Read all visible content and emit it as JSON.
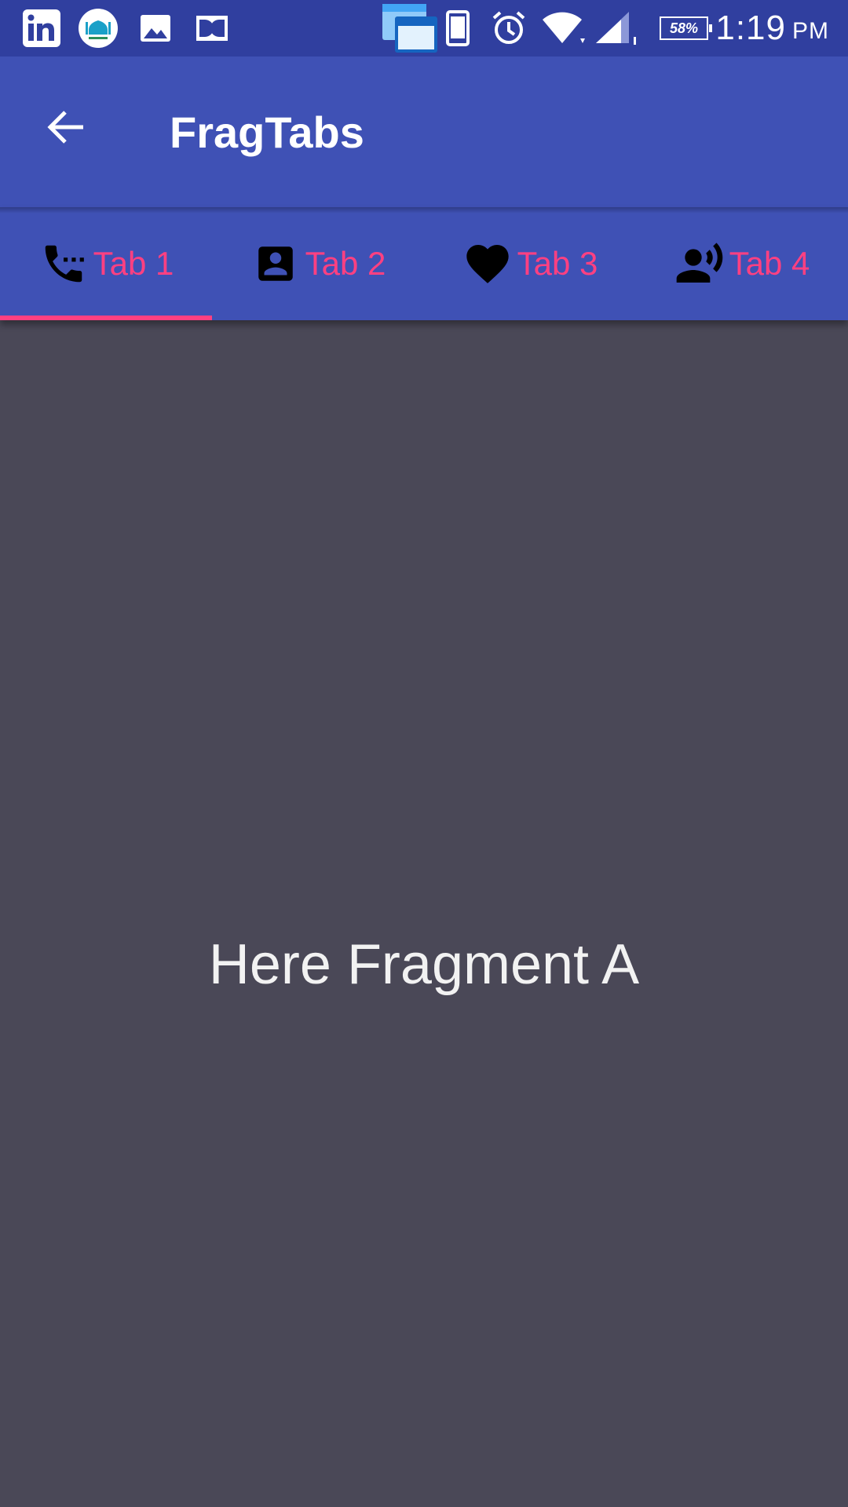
{
  "status_bar": {
    "battery_level": "58%",
    "time": "1:19",
    "ampm": "PM",
    "icons": [
      "linkedin-icon",
      "mosque-app-icon",
      "gallery-icon",
      "dolby-icon",
      "multi-window-icon",
      "phone-portrait-icon",
      "alarm-icon",
      "wifi-icon",
      "signal-icon",
      "battery-icon"
    ]
  },
  "app_bar": {
    "title": "FragTabs",
    "background": "#3f51b5"
  },
  "tabs": [
    {
      "label": "Tab 1",
      "icon": "phone-in-talk-icon",
      "selected": true
    },
    {
      "label": "Tab 2",
      "icon": "contact-card-icon",
      "selected": false
    },
    {
      "label": "Tab 3",
      "icon": "heart-icon",
      "selected": false
    },
    {
      "label": "Tab 4",
      "icon": "person-voice-icon",
      "selected": false
    }
  ],
  "colors": {
    "status_bar": "#303f9f",
    "primary": "#3f51b5",
    "accent": "#ff4081",
    "content_bg": "#4a4857"
  },
  "content": {
    "text": "Here Fragment A"
  }
}
